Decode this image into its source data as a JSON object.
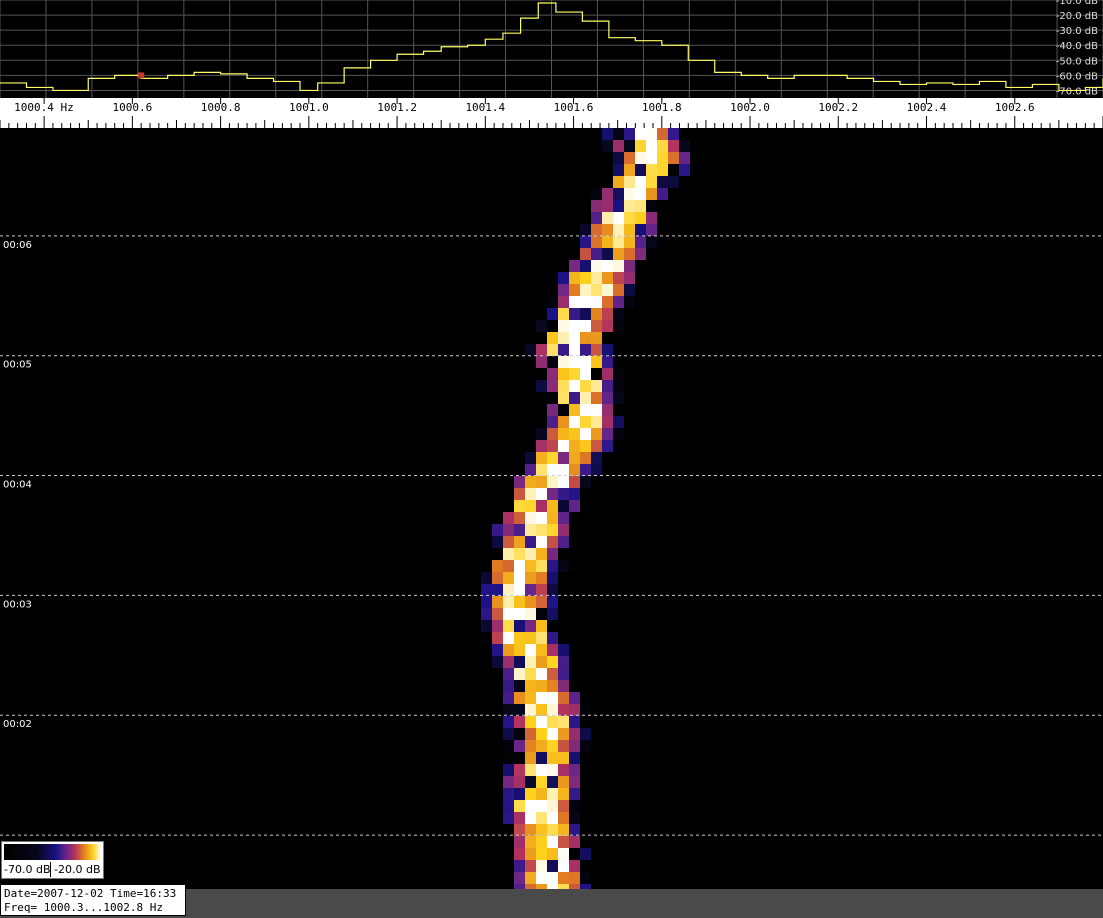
{
  "chart_data": {
    "type": "heatmap",
    "spectrum": {
      "x_unit": "Hz",
      "x_range": [
        1000.3,
        1002.8
      ],
      "y_range": [
        -75,
        -10
      ],
      "ytick_labels": [
        "-10.0 dB",
        "-20.0 dB",
        "-30.0 dB",
        "-40.0 dB",
        "-50.0 dB",
        "-60.0 dB",
        "-70.0 dB"
      ],
      "ytick_values": [
        -10,
        -20,
        -30,
        -40,
        -50,
        -60,
        -70
      ],
      "x": [
        1000.3,
        1000.36,
        1000.42,
        1000.5,
        1000.56,
        1000.62,
        1000.68,
        1000.74,
        1000.8,
        1000.86,
        1000.92,
        1000.98,
        1001.02,
        1001.08,
        1001.14,
        1001.2,
        1001.26,
        1001.3,
        1001.36,
        1001.4,
        1001.44,
        1001.48,
        1001.52,
        1001.56,
        1001.62,
        1001.68,
        1001.74,
        1001.8,
        1001.86,
        1001.92,
        1001.98,
        1002.04,
        1002.1,
        1002.16,
        1002.22,
        1002.28,
        1002.34,
        1002.4,
        1002.46,
        1002.52,
        1002.58,
        1002.64,
        1002.7,
        1002.76,
        1002.8
      ],
      "y": [
        -65,
        -68,
        -70,
        -62,
        -60,
        -62,
        -60,
        -58,
        -59,
        -62,
        -64,
        -70,
        -65,
        -55,
        -50,
        -46,
        -44,
        -41,
        -40,
        -36,
        -32,
        -22,
        -12,
        -18,
        -24,
        -35,
        -37,
        -40,
        -50,
        -58,
        -60,
        -62,
        -60,
        -60,
        -62,
        -64,
        -66,
        -65,
        -66,
        -64,
        -68,
        -66,
        -70,
        -68,
        -62
      ]
    },
    "waterfall": {
      "x_range": [
        1000.3,
        1002.8
      ],
      "time_labels": [
        "00:06",
        "00:05",
        "00:04",
        "00:03",
        "00:02"
      ],
      "color_scale": {
        "min_label": "-70.0 dB",
        "max_label": "-20.0 dB",
        "min": -70,
        "max": -20,
        "colors": [
          "#000000",
          "#07071c",
          "#1b1288",
          "#672589",
          "#b2325e",
          "#e27d20",
          "#ffd21b",
          "#ffffff"
        ]
      },
      "signal_track": [
        {
          "t": 6.9,
          "f": 1001.75
        },
        {
          "t": 6.6,
          "f": 1001.78
        },
        {
          "t": 6.3,
          "f": 1001.73
        },
        {
          "t": 6.0,
          "f": 1001.7
        },
        {
          "t": 5.7,
          "f": 1001.66
        },
        {
          "t": 5.4,
          "f": 1001.63
        },
        {
          "t": 5.1,
          "f": 1001.59
        },
        {
          "t": 4.8,
          "f": 1001.61
        },
        {
          "t": 4.5,
          "f": 1001.63
        },
        {
          "t": 4.2,
          "f": 1001.59
        },
        {
          "t": 3.9,
          "f": 1001.54
        },
        {
          "t": 3.6,
          "f": 1001.51
        },
        {
          "t": 3.3,
          "f": 1001.49
        },
        {
          "t": 3.0,
          "f": 1001.47
        },
        {
          "t": 2.7,
          "f": 1001.48
        },
        {
          "t": 2.4,
          "f": 1001.51
        },
        {
          "t": 2.1,
          "f": 1001.53
        },
        {
          "t": 1.8,
          "f": 1001.54
        },
        {
          "t": 1.5,
          "f": 1001.53
        },
        {
          "t": 1.2,
          "f": 1001.52
        },
        {
          "t": 0.9,
          "f": 1001.54
        },
        {
          "t": 0.6,
          "f": 1001.55
        }
      ]
    },
    "xtick_labels": [
      "1000.4 Hz",
      "1000.6",
      "1000.8",
      "1001.0",
      "1001.2",
      "1001.4",
      "1001.6",
      "1001.8",
      "1002.0",
      "1002.2",
      "1002.4",
      "1002.6"
    ],
    "xtick_values": [
      1000.4,
      1000.6,
      1000.8,
      1001.0,
      1001.2,
      1001.4,
      1001.6,
      1001.8,
      1002.0,
      1002.2,
      1002.4,
      1002.6
    ]
  },
  "status": {
    "date_time": "Date=2007-12-02 Time=16:33",
    "freq_range": "Freq= 1000.3...1002.8 Hz"
  },
  "colors": {
    "background": "#000000",
    "spectrum_trace": "#ffff66",
    "grid": "#555555",
    "marker": "#c0392b"
  }
}
